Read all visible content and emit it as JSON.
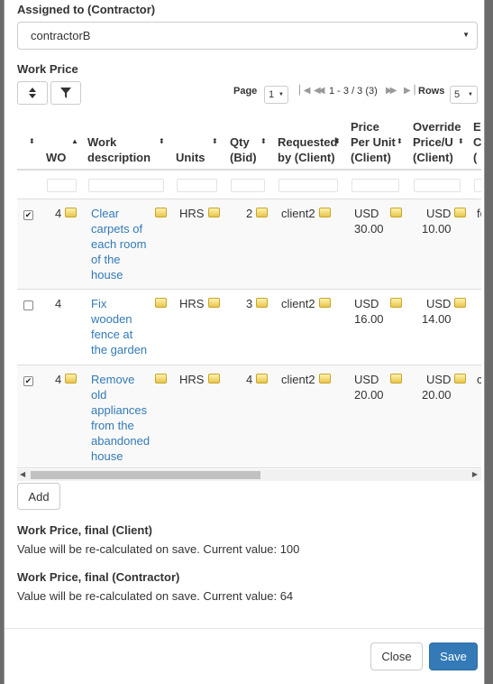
{
  "assigned": {
    "label": "Assigned to (Contractor)",
    "value": "contractorB"
  },
  "work_price": {
    "label": "Work Price",
    "pager": {
      "page_label": "Page",
      "page_value": "1",
      "range": "1 - 3 / 3 (3)",
      "rows_label": "Rows",
      "rows_value": "5"
    },
    "columns": [
      "WO",
      "Work description",
      "Units",
      "Qty (Bid)",
      "Requested by (Client)",
      "Price Per Unit (Client)",
      "Override Price/U (Client)"
    ],
    "header_lines": {
      "wo": [
        "WO"
      ],
      "desc": [
        "Work",
        "description"
      ],
      "units": [
        "Units"
      ],
      "qty": [
        "Qty",
        "(Bid)"
      ],
      "req": [
        "Requested",
        "by (Client)"
      ],
      "ppu": [
        "Price",
        "Per Unit",
        "(Client)"
      ],
      "ovr": [
        "Override",
        "Price/U",
        "(Client)"
      ],
      "cut": [
        "E",
        "C",
        "("
      ]
    },
    "rows": [
      {
        "checked": "✔",
        "wo": "4",
        "desc": [
          "Clear",
          "carpets of",
          "each room",
          "of the",
          "house"
        ],
        "units": "HRS",
        "qty": "2",
        "req": "client2",
        "ppu_cur": "USD",
        "ppu_val": "30.00",
        "ovr_cur": "USD",
        "ovr_val": "10.00",
        "cut": "fe"
      },
      {
        "checked": "",
        "wo": "4",
        "desc": [
          "Fix",
          "wooden",
          "fence at",
          "the garden"
        ],
        "units": "HRS",
        "qty": "3",
        "req": "client2",
        "ppu_cur": "USD",
        "ppu_val": "16.00",
        "ovr_cur": "USD",
        "ovr_val": "14.00",
        "cut": ""
      },
      {
        "checked": "✔",
        "wo": "4",
        "desc": [
          "Remove",
          "old",
          "appliances",
          "from the",
          "abandoned",
          "house"
        ],
        "units": "HRS",
        "qty": "4",
        "req": "client2",
        "ppu_cur": "USD",
        "ppu_val": "20.00",
        "ovr_cur": "USD",
        "ovr_val": "20.00",
        "cut": "c"
      }
    ],
    "add_label": "Add"
  },
  "final_client": {
    "label": "Work Price, final (Client)",
    "text": "Value will be re-calculated on save. Current value: 100"
  },
  "final_contractor": {
    "label": "Work Price, final (Contractor)",
    "text": "Value will be re-calculated on save. Current value: 64"
  },
  "footer": {
    "close_label": "Close",
    "save_label": "Save"
  },
  "colors": {
    "primary": "#337ab7",
    "link": "#337ab7",
    "backdrop": "#6b6b6b"
  },
  "icons": [
    "sort-icon",
    "filter-icon",
    "first-page-icon",
    "prev-page-icon",
    "next-page-icon",
    "last-page-icon",
    "edit-icon",
    "chevron-down-icon"
  ]
}
